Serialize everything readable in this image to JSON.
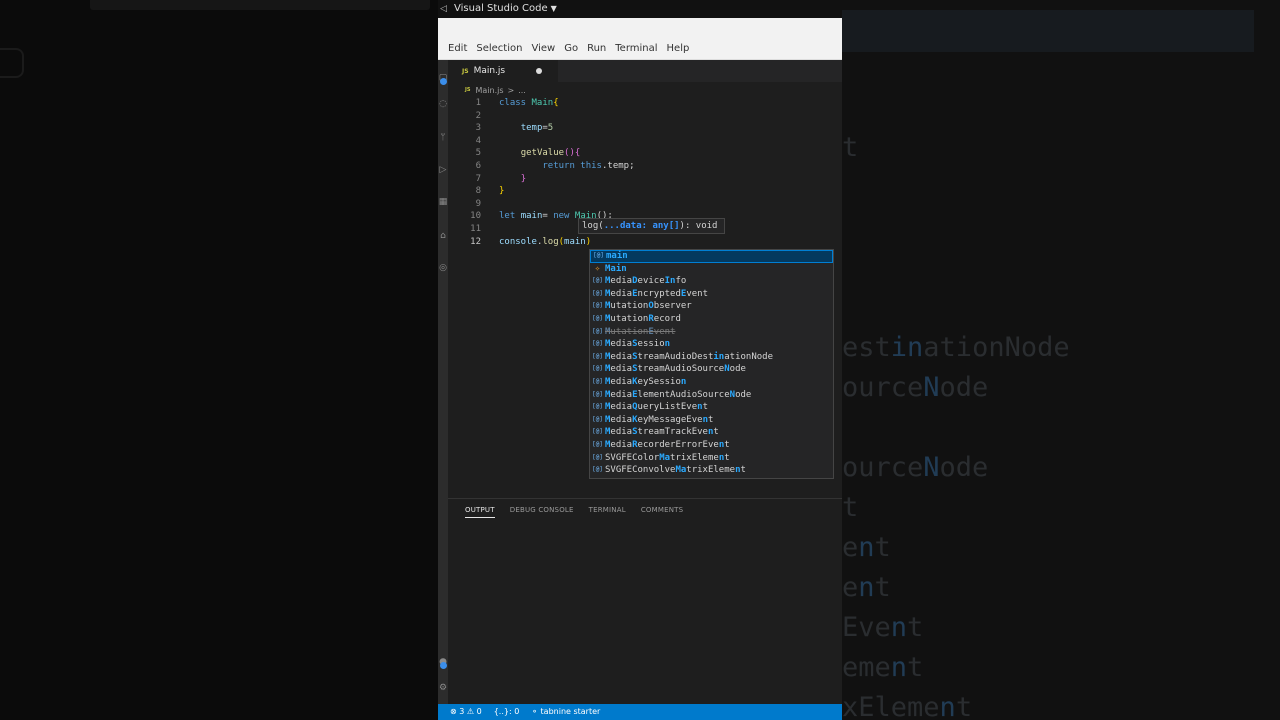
{
  "window": {
    "title": "Visual Studio Code"
  },
  "menu": [
    "Edit",
    "Selection",
    "View",
    "Go",
    "Run",
    "Terminal",
    "Help"
  ],
  "tab": {
    "icon_text": "JS",
    "label": "Main.js"
  },
  "breadcrumb": {
    "icon_text": "JS",
    "file": "Main.js",
    "sep": ">",
    "more": "..."
  },
  "code_lines": [
    {
      "n": "1"
    },
    {
      "n": "2"
    },
    {
      "n": "3"
    },
    {
      "n": "4"
    },
    {
      "n": "5"
    },
    {
      "n": "6"
    },
    {
      "n": "7"
    },
    {
      "n": "8"
    },
    {
      "n": "9"
    },
    {
      "n": "10"
    },
    {
      "n": "11"
    },
    {
      "n": "12"
    }
  ],
  "code_tokens": {
    "class_kw": "class",
    "class_name": "Main",
    "brace_open": "{",
    "field": "temp",
    "eq": "=",
    "five": "5",
    "method": "getValue",
    "parens_brace": "(){",
    "return_kw": "return",
    "this_kw": "this",
    "temp_ref": ".temp;",
    "brace_close": "}",
    "let_kw": "let",
    "main_var": "main",
    "eq_sp": "= ",
    "new_kw": "new",
    "ctor": "Main",
    "ctor_tail": "();",
    "console": "console",
    "dot": ".",
    "log": "log",
    "paren_open": "(",
    "arg": "main",
    "paren_close": ")"
  },
  "signature_help": {
    "pre": "log(",
    "param": "...data: any[]",
    "post": "): void"
  },
  "suggestions": [
    {
      "icon": "[@]",
      "pre": "",
      "m": "main",
      "post": ""
    },
    {
      "icon": "✧",
      "pre": "",
      "m": "Main",
      "post": ""
    },
    {
      "icon": "[@]",
      "pre": "",
      "m": "M",
      "mid": "edia",
      "m2": "D",
      "mid2": "evice",
      "m3": "In",
      "post": "fo"
    },
    {
      "icon": "[@]",
      "pre": "",
      "m": "M",
      "mid": "edia",
      "m2": "E",
      "mid2": "ncrypted",
      "m3": "E",
      "post": "vent"
    },
    {
      "icon": "[@]",
      "pre": "",
      "m": "M",
      "mid": "utation",
      "m2": "O",
      "mid2": "bserver",
      "m3": "",
      "post": ""
    },
    {
      "icon": "[@]",
      "pre": "",
      "m": "M",
      "mid": "utation",
      "m2": "R",
      "mid2": "ecord",
      "m3": "",
      "post": ""
    },
    {
      "icon": "[@]",
      "pre": "",
      "m": "M",
      "mid": "utation",
      "m2": "E",
      "mid2": "vent",
      "m3": "",
      "post": "",
      "deprecated": true
    },
    {
      "icon": "[@]",
      "pre": "",
      "m": "M",
      "mid": "edia",
      "m2": "S",
      "mid2": "essio",
      "m3": "n",
      "post": ""
    },
    {
      "icon": "[@]",
      "pre": "",
      "m": "M",
      "mid": "edia",
      "m2": "S",
      "mid2": "treamAudioDest",
      "m3": "in",
      "post": "ationNode"
    },
    {
      "icon": "[@]",
      "pre": "",
      "m": "M",
      "mid": "edia",
      "m2": "S",
      "mid2": "treamAudioSource",
      "m3": "N",
      "post": "ode"
    },
    {
      "icon": "[@]",
      "pre": "",
      "m": "M",
      "mid": "edia",
      "m2": "K",
      "mid2": "eySessio",
      "m3": "n",
      "post": ""
    },
    {
      "icon": "[@]",
      "pre": "",
      "m": "M",
      "mid": "edia",
      "m2": "E",
      "mid2": "lementAudioSource",
      "m3": "N",
      "post": "ode"
    },
    {
      "icon": "[@]",
      "pre": "",
      "m": "M",
      "mid": "edia",
      "m2": "Q",
      "mid2": "ueryListEve",
      "m3": "n",
      "post": "t"
    },
    {
      "icon": "[@]",
      "pre": "",
      "m": "M",
      "mid": "edia",
      "m2": "K",
      "mid2": "eyMessageEve",
      "m3": "n",
      "post": "t"
    },
    {
      "icon": "[@]",
      "pre": "",
      "m": "M",
      "mid": "edia",
      "m2": "S",
      "mid2": "treamTrackEve",
      "m3": "n",
      "post": "t"
    },
    {
      "icon": "[@]",
      "pre": "",
      "m": "M",
      "mid": "edia",
      "m2": "R",
      "mid2": "ecorderErrorEve",
      "m3": "n",
      "post": "t"
    },
    {
      "icon": "[@]",
      "pre": "SVGFEColor",
      "m": "Ma",
      "mid": "trixEleme",
      "m2": "n",
      "mid2": "t",
      "m3": "",
      "post": ""
    },
    {
      "icon": "[@]",
      "pre": "SVGFEConvolve",
      "m": "Ma",
      "mid": "trixEleme",
      "m2": "n",
      "mid2": "t",
      "m3": "",
      "post": ""
    }
  ],
  "panel_tabs": [
    "OUTPUT",
    "DEBUG CONSOLE",
    "TERMINAL",
    "COMMENTS"
  ],
  "status": {
    "errors": "⊗ 3 ⚠ 0",
    "braces": "{..}: 0",
    "tabnine": "⚬ tabnine starter"
  },
  "backdrop_right": [
    {
      "pre": "",
      "hl": "",
      "post": "t"
    },
    {
      "pre": "est",
      "hl": "in",
      "post": "ationNode"
    },
    {
      "pre": "ource",
      "hl": "N",
      "post": "ode"
    },
    {
      "pre": "ource",
      "hl": "N",
      "post": "ode"
    },
    {
      "pre": "",
      "hl": "",
      "post": "t"
    },
    {
      "pre": "e",
      "hl": "n",
      "post": "t"
    },
    {
      "pre": "e",
      "hl": "n",
      "post": "t"
    },
    {
      "pre": "Eve",
      "hl": "n",
      "post": "t"
    },
    {
      "pre": "eme",
      "hl": "n",
      "post": "t"
    },
    {
      "pre": "xEleme",
      "hl": "n",
      "post": "t"
    }
  ],
  "colors": {
    "accent": "#007acc",
    "selection": "#04395e",
    "match": "#2aaaff"
  }
}
